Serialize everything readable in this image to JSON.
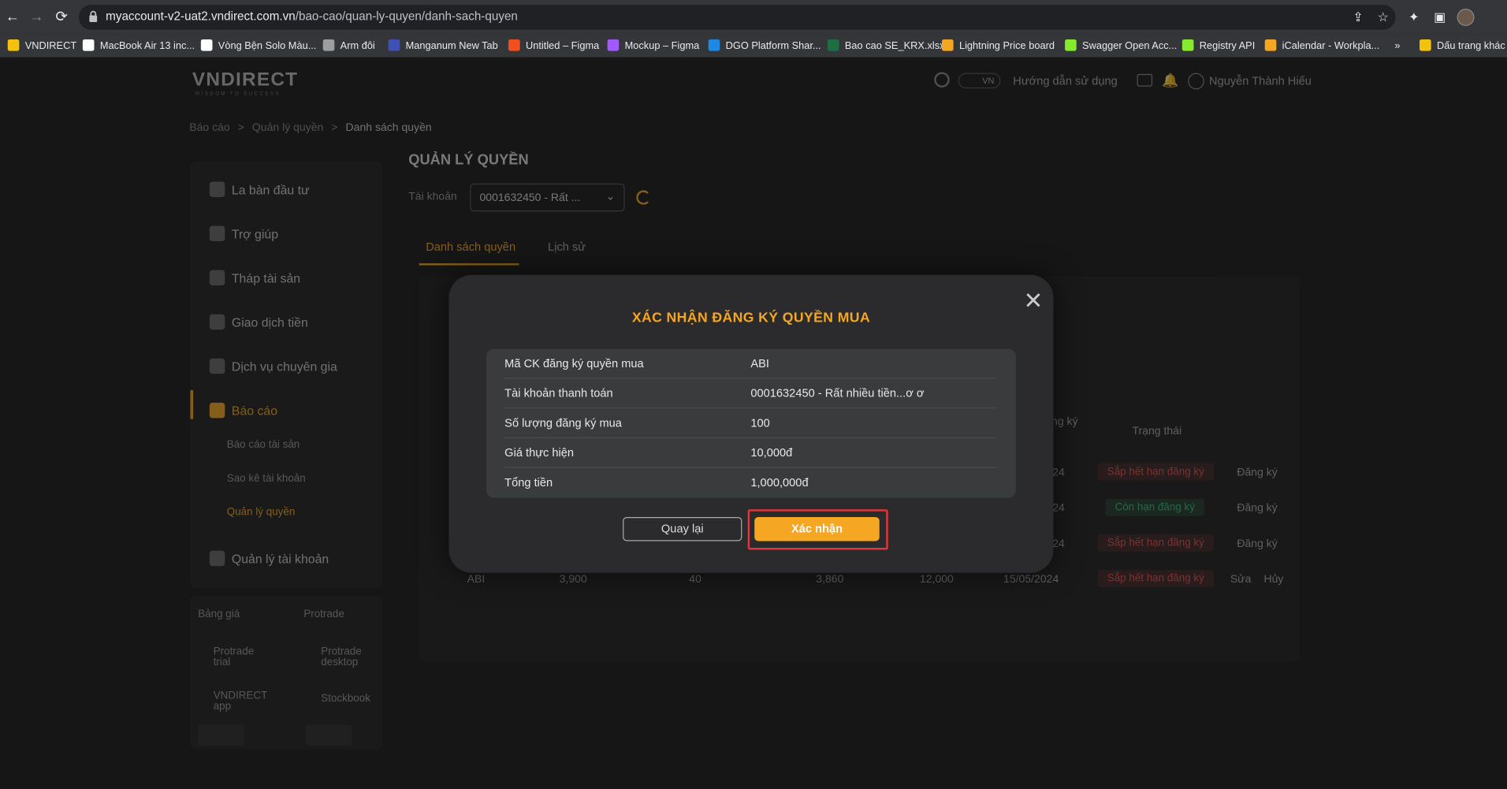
{
  "browser": {
    "url_host": "myaccount-v2-uat2.vndirect.com.vn",
    "url_path": "/bao-cao/quan-ly-quyen/danh-sach-quyen",
    "bookmarks": [
      {
        "label": "VNDIRECT",
        "color": "#f4c20d"
      },
      {
        "label": "MacBook Air 13 inc...",
        "color": "#ffffff"
      },
      {
        "label": "Vòng Bện Solo Màu...",
        "color": "#ffffff"
      },
      {
        "label": "Arm đôi",
        "color": "#9e9e9e"
      },
      {
        "label": "Manganum New Tab",
        "color": "#3f51b5"
      },
      {
        "label": "Untitled – Figma",
        "color": "#f24e1e"
      },
      {
        "label": "Mockup – Figma",
        "color": "#a259ff"
      },
      {
        "label": "DGO Platform Shar...",
        "color": "#1e88e5"
      },
      {
        "label": "Bao cao SE_KRX.xlsx",
        "color": "#1d6f42"
      },
      {
        "label": "Lightning Price board",
        "color": "#f5a623"
      },
      {
        "label": "Swagger Open Acc...",
        "color": "#85ea2d"
      },
      {
        "label": "Registry API",
        "color": "#85ea2d"
      },
      {
        "label": "iCalendar - Workpla...",
        "color": "#f5a623"
      },
      {
        "label": "»",
        "color": ""
      },
      {
        "label": "Dấu trang khác",
        "color": "#f4c20d"
      }
    ]
  },
  "header": {
    "logo": "VNDIRECT",
    "logo_sub": "WISDOM TO SUCCESS",
    "lang": "VN",
    "guide": "Hướng dẫn sử dụng",
    "user": "Nguyễn Thành Hiếu"
  },
  "breadcrumb": {
    "item1": "Báo cáo",
    "sep": ">",
    "item2": "Quản lý quyền",
    "current": "Danh sách quyền"
  },
  "sidebar": {
    "items": [
      "La bàn đầu tư",
      "Trợ giúp",
      "Tháp tài sản",
      "Giao dịch tiền",
      "Dịch vụ chuyên gia",
      "Báo cáo",
      "Quản lý tài khoản"
    ],
    "sub_items": [
      "Báo cáo tài sản",
      "Sao kê tài khoản",
      "Quản lý quyền"
    ]
  },
  "tools": [
    "Bảng giá",
    "Protrade",
    "Protrade trial",
    "Protrade desktop",
    "VNDIRECT app",
    "Stockbook"
  ],
  "main": {
    "title": "QUẢN LÝ QUYỀN",
    "account_label": "Tài khoản",
    "account_value": "0001632450 - Rất ...",
    "tabs": [
      "Danh sách quyền",
      "Lịch sử"
    ],
    "col_dang_ky": "ng ký",
    "col_trang_thai": "Trạng thái",
    "rows": [
      {
        "date": "24",
        "status": "Sắp hết hạn đăng ký",
        "status_type": "red",
        "action": "Đăng ký"
      },
      {
        "date": "24",
        "status": "Còn hạn đăng ký",
        "status_type": "green",
        "action": "Đăng ký"
      },
      {
        "date": "24",
        "status": "Sắp hết hạn đăng ký",
        "status_type": "red",
        "action": "Đăng ký"
      }
    ],
    "last_row": {
      "symbol": "ABI",
      "c1": "3,900",
      "c2": "40",
      "c3": "3,860",
      "c4": "12,000",
      "date": "15/05/2024",
      "status": "Sắp hết hạn đăng ký",
      "action1": "Sửa",
      "action2": "Hủy"
    }
  },
  "modal": {
    "title": "XÁC NHẬN ĐĂNG KÝ QUYỀN MUA",
    "rows": [
      {
        "label": "Mã CK đăng ký quyền mua",
        "value": "ABI"
      },
      {
        "label": "Tài khoản thanh toán",
        "value": "0001632450 - Rất nhiều tiền...ơ ơ"
      },
      {
        "label": "Số lượng đăng ký mua",
        "value": "100"
      },
      {
        "label": "Giá thực hiện",
        "value": "10,000đ"
      },
      {
        "label": "Tổng tiền",
        "value": "1,000,000đ"
      }
    ],
    "back_label": "Quay lại",
    "confirm_label": "Xác nhận",
    "accent": "#f5a623",
    "highlight_color": "#e3363b"
  }
}
